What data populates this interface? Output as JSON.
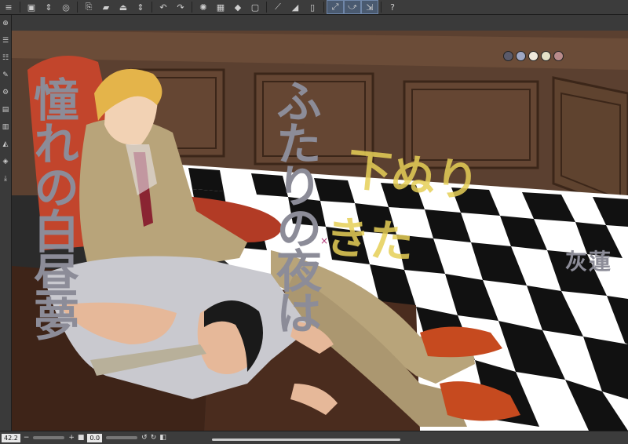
{
  "toolbar": {
    "icons": [
      "menu-icon",
      "new-icon",
      "chevron-updown-icon",
      "undo-history-icon",
      "layer-export-icon",
      "open-folder-icon",
      "save-icon",
      "chevron-updown-icon",
      "undo-icon",
      "redo-icon",
      "transform-icon",
      "fill-icon",
      "select-icon",
      "clear-icon",
      "snap-icon",
      "fill-area-icon",
      "snap-line-icon",
      "snap-curve-icon",
      "snap-ruler-icon",
      "help-icon"
    ]
  },
  "leftbar": {
    "icons": [
      "zoom-icon",
      "layer-icon",
      "layer2-icon",
      "brush-icon",
      "settings-icon",
      "grid-icon",
      "grid2-icon",
      "eraser-icon",
      "stack-icon",
      "import-icon"
    ]
  },
  "canvas": {
    "title_left": "憧れの白昼夢",
    "title_center": "ふたりの夜は",
    "author": "灰蓮",
    "sketch_line1": "下ぬり",
    "sketch_line2": "きた",
    "swatch_colors": [
      "#5a5a6a",
      "#9ea7c4",
      "#f0e9dc",
      "#e3e0c6",
      "#b98b8b"
    ]
  },
  "bottombar": {
    "zoom": "42.2",
    "rotate": "0.0",
    "minus_label": "−",
    "plus_label": "+"
  }
}
